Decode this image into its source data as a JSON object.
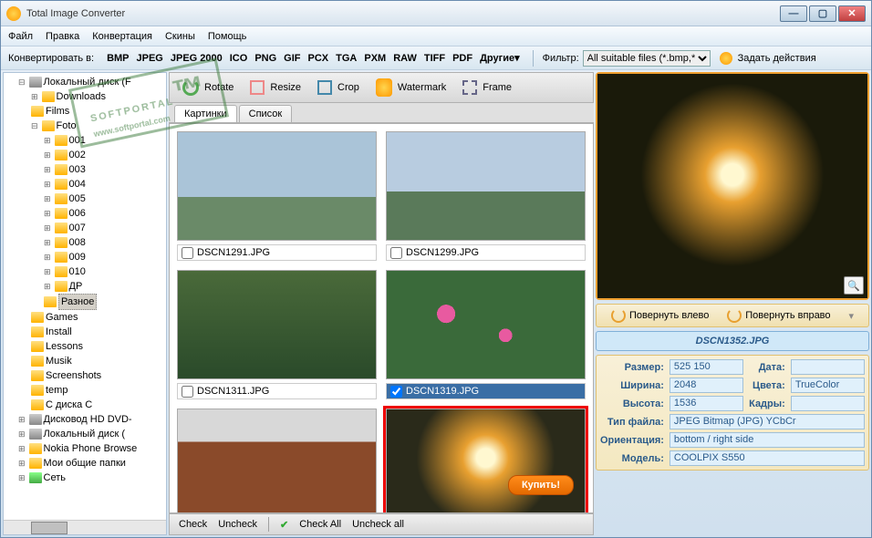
{
  "window": {
    "title": "Total Image Converter"
  },
  "menu": {
    "file": "Файл",
    "edit": "Правка",
    "convert": "Конвертация",
    "skins": "Скины",
    "help": "Помощь"
  },
  "fmtbar": {
    "label": "Конвертировать в:",
    "formats": [
      "BMP",
      "JPEG",
      "JPEG 2000",
      "ICO",
      "PNG",
      "GIF",
      "PCX",
      "TGA",
      "PXM",
      "RAW",
      "TIFF",
      "PDF",
      "Другие▾"
    ],
    "filter_label": "Фильтр:",
    "filter_value": "All suitable files (*.bmp,*.j",
    "actions_label": "Задать действия"
  },
  "tree": {
    "root": "Локальный диск (F",
    "downloads": "Downloads",
    "films": "Films",
    "foto": "Foto",
    "foto_children": [
      "001",
      "002",
      "003",
      "004",
      "005",
      "006",
      "007",
      "008",
      "009",
      "010",
      "ДР",
      "Разное"
    ],
    "games": "Games",
    "install": "Install",
    "lessons": "Lessons",
    "musik": "Musik",
    "screenshots": "Screenshots",
    "temp": "temp",
    "cdisk": "С диска С",
    "dvd": "Дисковод HD DVD-",
    "localdisk": "Локальный диск (",
    "nokia": "Nokia Phone Browse",
    "shared": "Мои общие папки",
    "network": "Сеть"
  },
  "toolbar": {
    "rotate": "Rotate",
    "resize": "Resize",
    "crop": "Crop",
    "watermark": "Watermark",
    "frame": "Frame"
  },
  "tabs": {
    "thumbs": "Картинки",
    "list": "Список"
  },
  "thumbs": [
    {
      "name": "DSCN1291.JPG",
      "cls": "sky1",
      "checked": false,
      "selected": false
    },
    {
      "name": "DSCN1299.JPG",
      "cls": "sky2",
      "checked": false,
      "selected": false
    },
    {
      "name": "DSCN1311.JPG",
      "cls": "forest",
      "checked": false,
      "selected": false
    },
    {
      "name": "DSCN1319.JPG",
      "cls": "flowers",
      "checked": true,
      "selected": false
    },
    {
      "name": "",
      "cls": "church",
      "checked": false,
      "selected": false
    },
    {
      "name": "",
      "cls": "sunset",
      "checked": false,
      "selected": true
    }
  ],
  "buy": "Купить!",
  "checkbar": {
    "check": "Check",
    "uncheck": "Uncheck",
    "checkall": "Check All",
    "uncheckall": "Uncheck all"
  },
  "rotbar": {
    "left": "Повернуть влево",
    "right": "Повернуть вправо"
  },
  "preview": {
    "filename": "DSCN1352.JPG"
  },
  "meta": {
    "size_k": "Размер:",
    "size_v": "525 150",
    "date_k": "Дата:",
    "date_v": "",
    "width_k": "Ширина:",
    "width_v": "2048",
    "colors_k": "Цвета:",
    "colors_v": "TrueColor",
    "height_k": "Высота:",
    "height_v": "1536",
    "frames_k": "Кадры:",
    "frames_v": "",
    "ftype_k": "Тип файла:",
    "ftype_v": "JPEG Bitmap (JPG) YCbCr",
    "orient_k": "Ориентация:",
    "orient_v": "bottom / right side",
    "model_k": "Модель:",
    "model_v": "COOLPIX S550"
  },
  "watermark": {
    "big": "SOFTPORTAL",
    "small": "www.softportal.com"
  }
}
